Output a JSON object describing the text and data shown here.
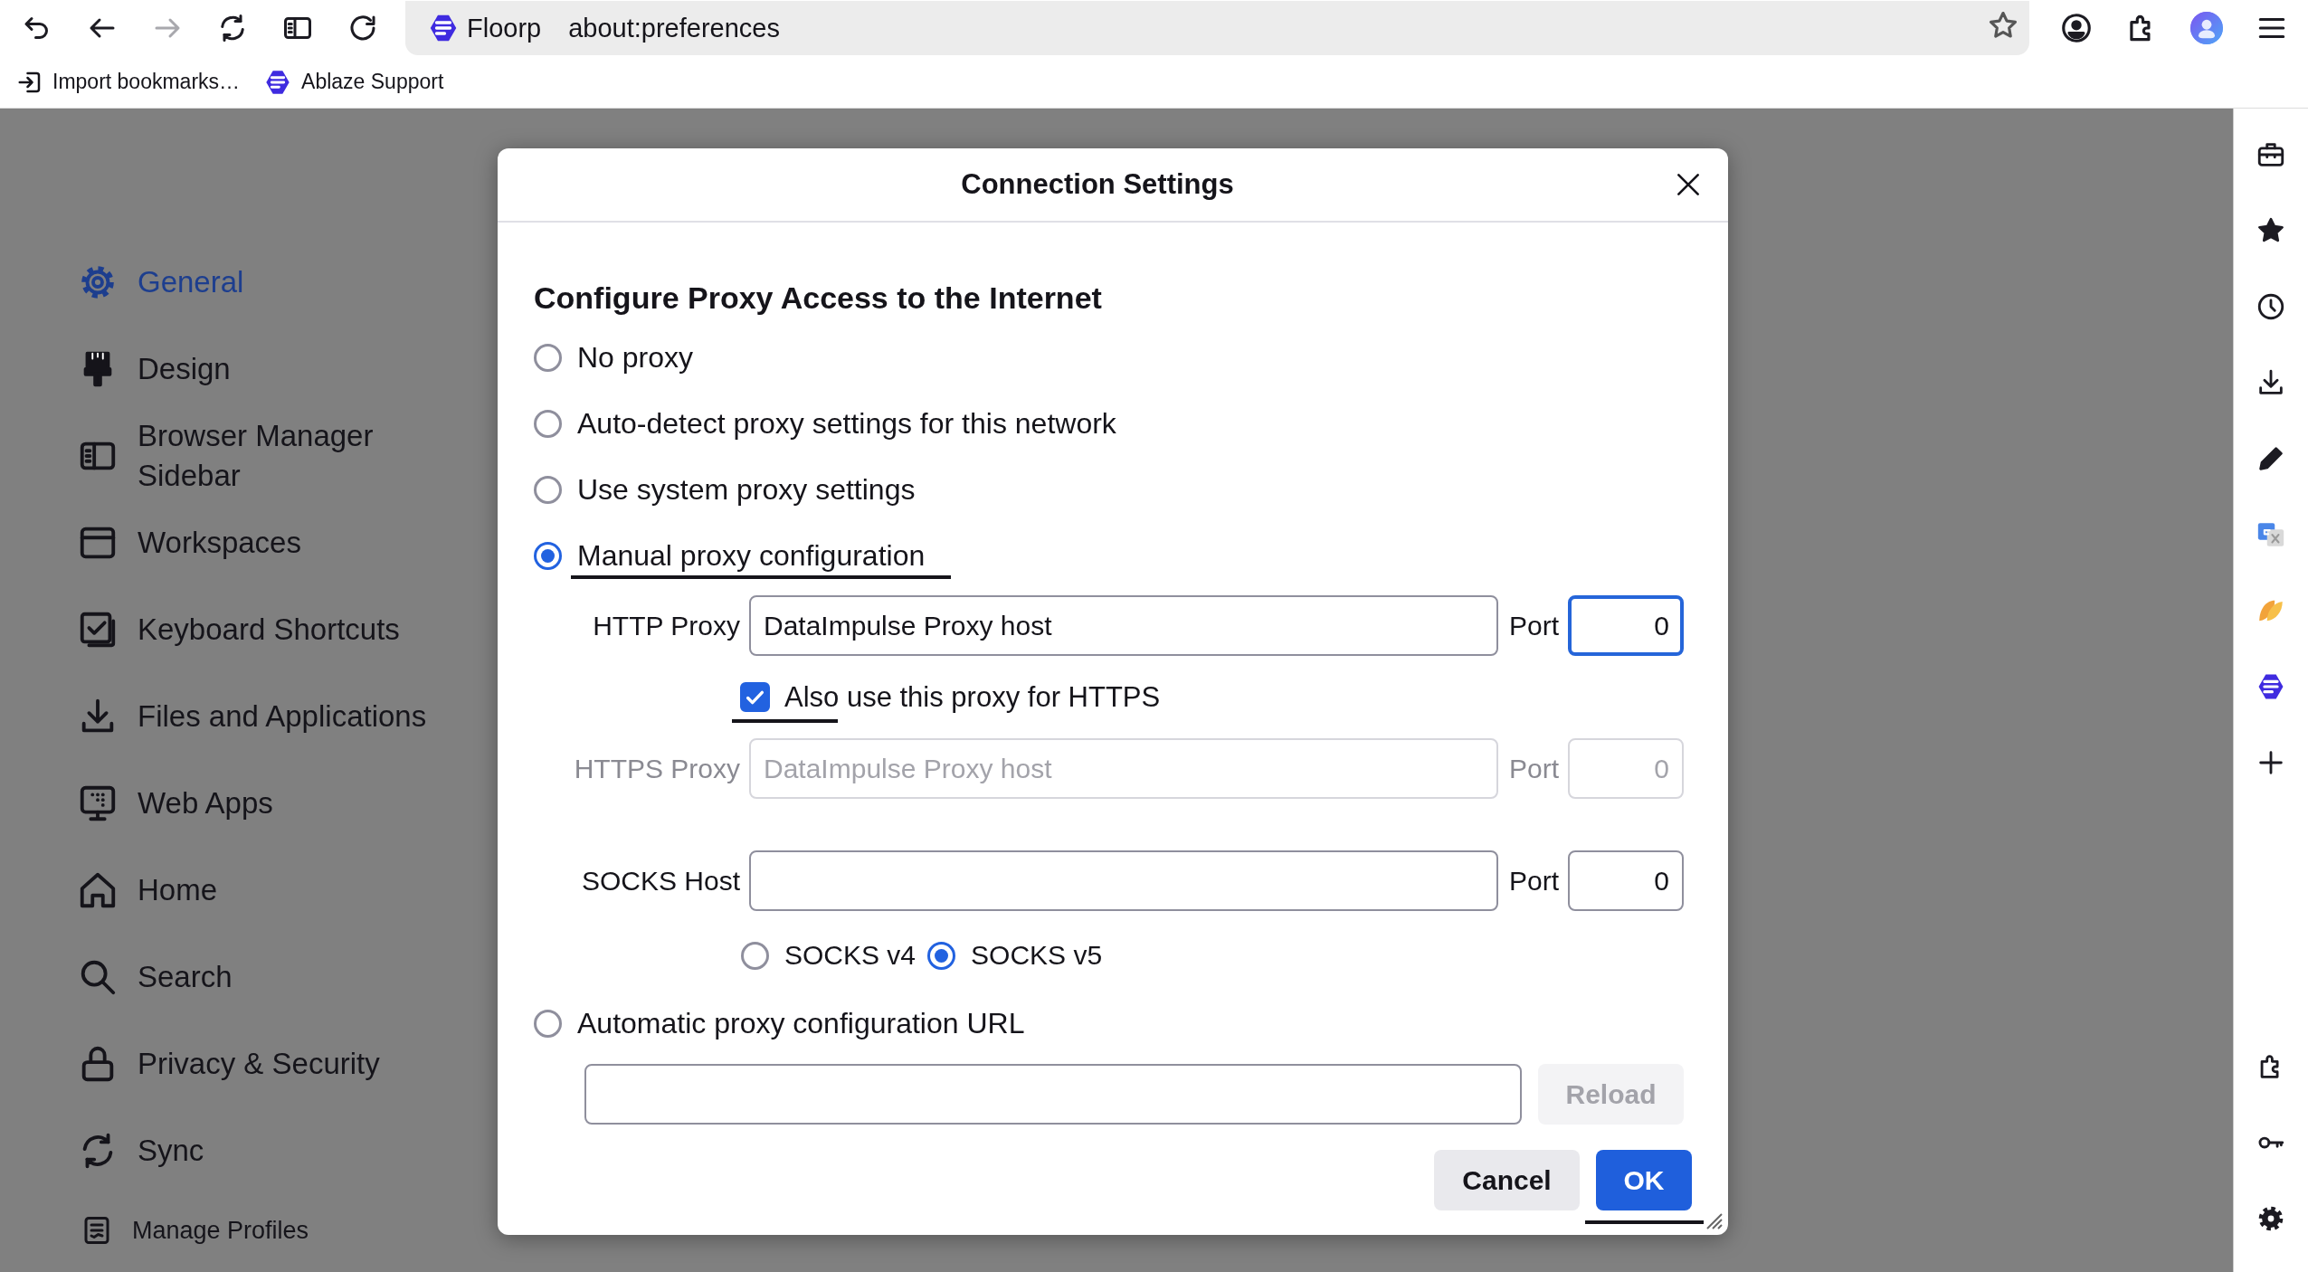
{
  "toolbar": {
    "buttons": [
      {
        "kind": "undo",
        "disabled": false
      },
      {
        "kind": "back",
        "disabled": false
      },
      {
        "kind": "forward",
        "disabled": true
      },
      {
        "kind": "sync",
        "disabled": false
      },
      {
        "kind": "sidebar",
        "disabled": false
      },
      {
        "kind": "reload",
        "disabled": false
      }
    ],
    "url_bar": {
      "identity": "Floorp",
      "url": "about:preferences"
    }
  },
  "bookmarks": [
    {
      "kind": "import",
      "label": "Import bookmarks…"
    },
    {
      "kind": "floorp",
      "label": "Ablaze Support"
    }
  ],
  "sidebar": {
    "items": [
      {
        "kind": "gear",
        "label": "General",
        "selected": true
      },
      {
        "kind": "brush",
        "label": "Design",
        "selected": false
      },
      {
        "kind": "panel",
        "label": "Browser Manager Sidebar",
        "selected": false
      },
      {
        "kind": "window",
        "label": "Workspaces",
        "selected": false
      },
      {
        "kind": "checkbox",
        "label": "Keyboard Shortcuts",
        "selected": false
      },
      {
        "kind": "download",
        "label": "Files and Applications",
        "selected": false
      },
      {
        "kind": "webapps",
        "label": "Web Apps",
        "selected": false
      },
      {
        "kind": "home",
        "label": "Home",
        "selected": false
      },
      {
        "kind": "search",
        "label": "Search",
        "selected": false
      },
      {
        "kind": "lock",
        "label": "Privacy & Security",
        "selected": false
      },
      {
        "kind": "sync",
        "label": "Sync",
        "selected": false
      },
      {
        "kind": "profiles",
        "label": "Manage Profiles",
        "selected": false
      }
    ]
  },
  "dialog": {
    "title": "Connection Settings",
    "heading": "Configure Proxy Access to the Internet",
    "proxy_modes": [
      {
        "kind": "plain",
        "label": "No proxy",
        "selected": false
      },
      {
        "kind": "plain",
        "label": "Auto-detect proxy settings for this network",
        "selected": false
      },
      {
        "kind": "plain",
        "label": "Use system proxy settings",
        "selected": false
      },
      {
        "kind": "manual",
        "label": "Manual proxy configuration",
        "selected": true,
        "underlined": true
      },
      {
        "kind": "auto_url",
        "label": "Automatic proxy configuration URL",
        "selected": false
      }
    ],
    "manual": {
      "http_proxy": {
        "label": "HTTP Proxy",
        "value": "DataImpulse Proxy host",
        "port_label": "Port",
        "port": "0",
        "port_focused": true,
        "disabled": false
      },
      "https_checkbox": {
        "label": "Also use this proxy for HTTPS",
        "checked": true,
        "underlined": true
      },
      "https_proxy": {
        "label": "HTTPS Proxy",
        "value": "DataImpulse Proxy host",
        "port_label": "Port",
        "port": "0",
        "port_focused": false,
        "disabled": true
      },
      "socks_host": {
        "label": "SOCKS Host",
        "port_label": "Port",
        "port": "0",
        "port_focused": false,
        "disabled": false
      },
      "socks_versions": [
        {
          "label": "SOCKS v4",
          "selected": false
        },
        {
          "label": "SOCKS v5",
          "selected": true
        }
      ]
    },
    "auto_url": {
      "reload": {
        "label": "Reload",
        "disabled": true
      }
    },
    "buttons": [
      {
        "kind": "secondary",
        "label": "Cancel"
      },
      {
        "kind": "primary",
        "label": "OK",
        "underlined": true
      }
    ]
  }
}
